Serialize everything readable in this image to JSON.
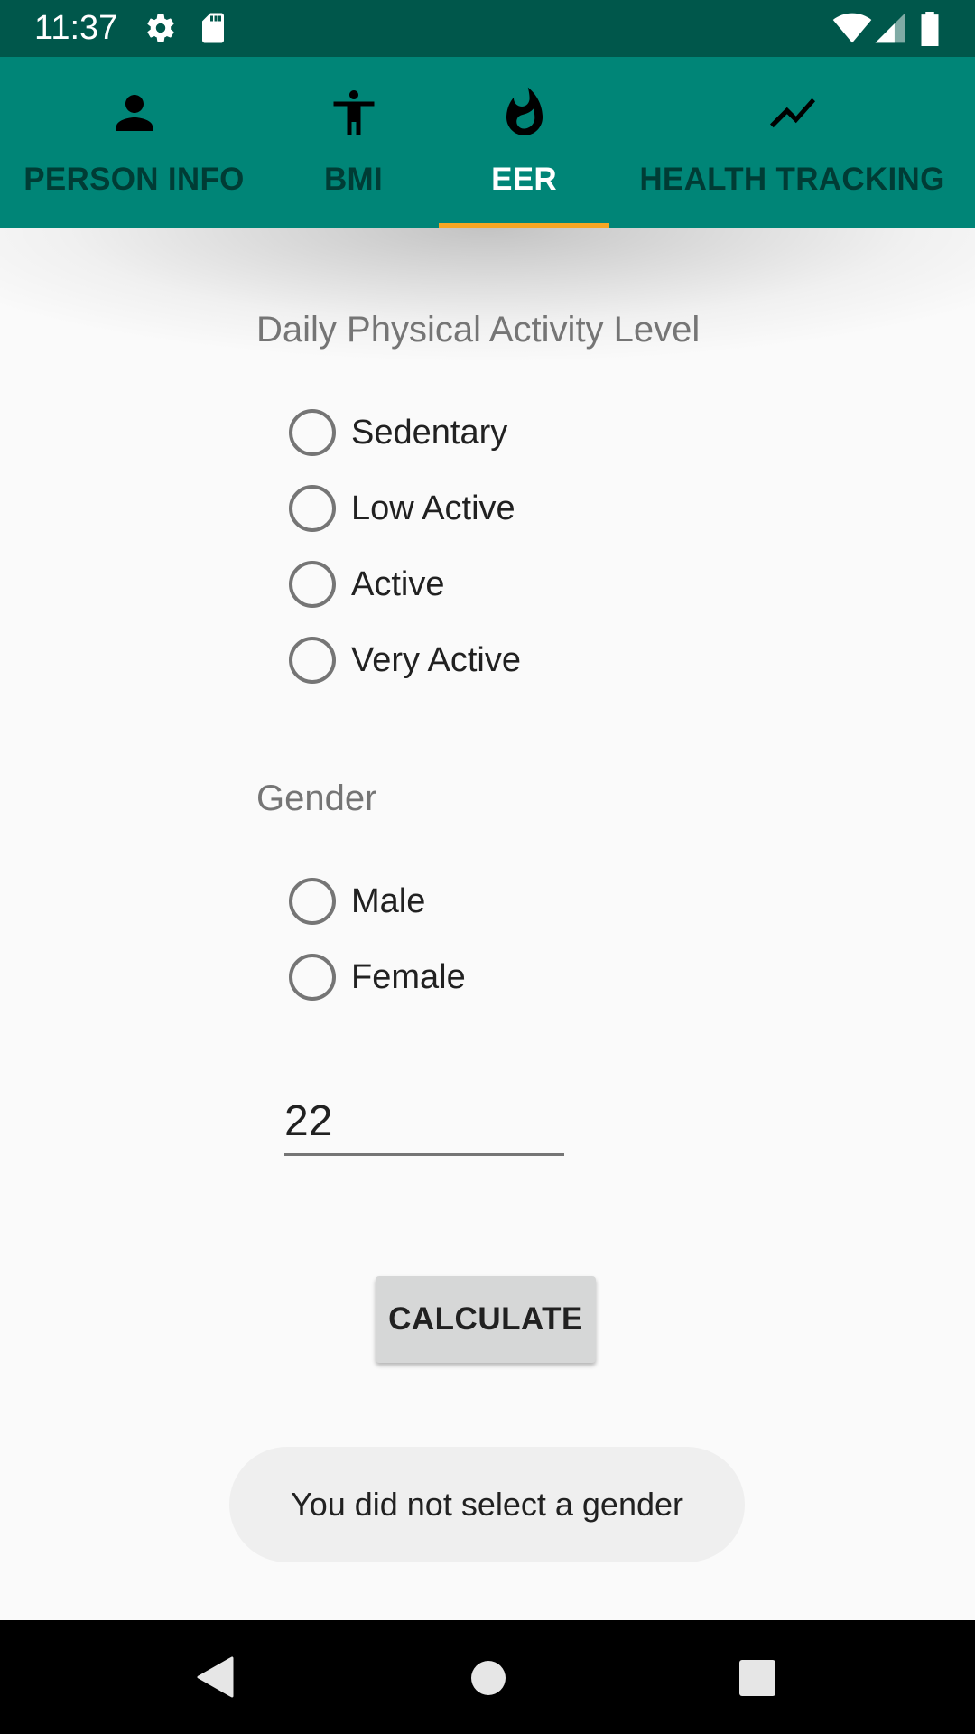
{
  "status_bar": {
    "time": "11:37",
    "icons": [
      "settings-icon",
      "sd-card-icon",
      "wifi-icon",
      "signal-icon",
      "battery-icon"
    ]
  },
  "tabs": [
    {
      "label": "PERSON INFO",
      "icon": "person-icon",
      "selected": false
    },
    {
      "label": "BMI",
      "icon": "accessibility-icon",
      "selected": false
    },
    {
      "label": "EER",
      "icon": "flame-icon",
      "selected": true
    },
    {
      "label": "HEALTH TRACKING",
      "icon": "trending-icon",
      "selected": false
    }
  ],
  "colors": {
    "status_bar": "#00574b",
    "primary": "#008577",
    "accent": "#f6a623"
  },
  "activity": {
    "title": "Daily Physical Activity Level",
    "options": [
      "Sedentary",
      "Low Active",
      "Active",
      "Very Active"
    ]
  },
  "gender": {
    "title": "Gender",
    "options": [
      "Male",
      "Female"
    ]
  },
  "age_field": {
    "value": "22"
  },
  "calculate_button": {
    "label": "CALCULATE"
  },
  "toast": {
    "message": "You did not select a gender"
  },
  "nav_bar": {
    "icons": [
      "back-icon",
      "home-icon",
      "recents-icon"
    ]
  }
}
